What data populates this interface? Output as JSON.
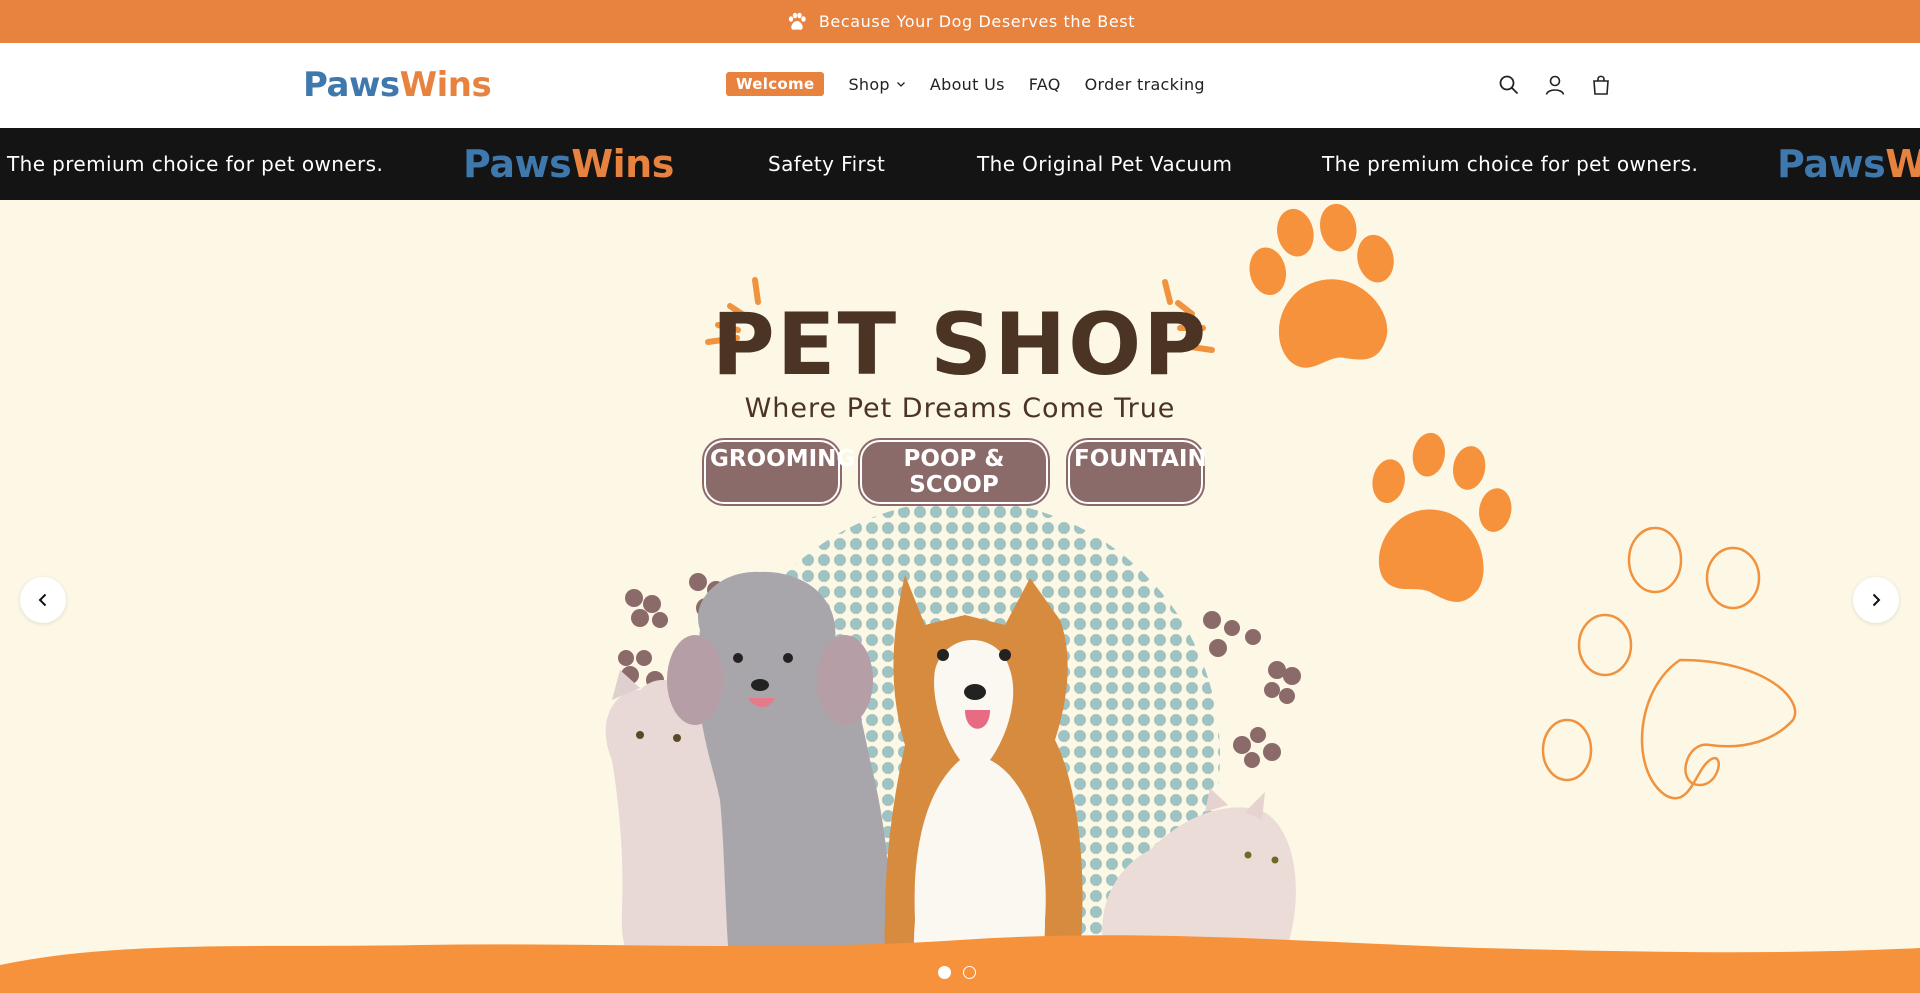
{
  "announcement": {
    "text": "Because Your Dog Deserves the Best",
    "icon": "paw-icon"
  },
  "header": {
    "logo_parts": [
      "Pa",
      "ws",
      "Wins"
    ],
    "nav": {
      "welcome": "Welcome",
      "shop": "Shop",
      "about": "About Us",
      "faq": "FAQ",
      "order_tracking": "Order tracking"
    },
    "icons": [
      "search-icon",
      "account-icon",
      "cart-icon"
    ]
  },
  "marquee": {
    "items": [
      "The premium choice for pet owners.",
      "Safety First",
      "The Original Pet Vacuum",
      "The premium choice for pet owners."
    ],
    "logo_parts": [
      "Pa",
      "ws",
      "Wins"
    ]
  },
  "hero": {
    "title": "PET SHOP",
    "subtitle": "Where Pet Dreams Come True",
    "tags": [
      "GROOMING",
      "POOP & SCOOP",
      "FOUNTAIN"
    ],
    "slides_total": 2,
    "slide_active": 1
  },
  "colors": {
    "brand_orange": "#e8823f",
    "brand_blue": "#3e78ad",
    "hero_bg": "#fdf8e6",
    "title_brown": "#4b3424",
    "tag_brown": "#8b6a6a",
    "paw_orange": "#f7923c",
    "dot_pattern": "#9fc2c2",
    "marquee_bg": "#141414"
  }
}
